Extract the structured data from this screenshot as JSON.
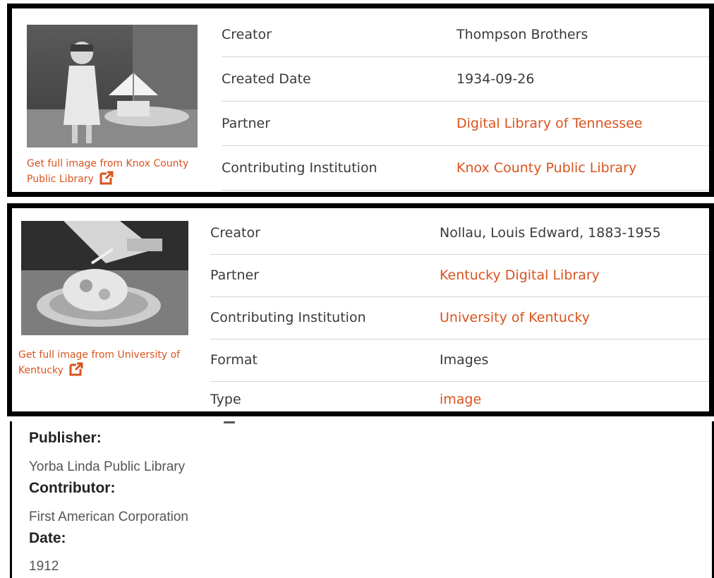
{
  "panel1": {
    "get_full_image": "Get full image from Knox County Public Library",
    "rows": [
      {
        "label": "Creator",
        "value": "Thompson Brothers",
        "link": false
      },
      {
        "label": "Created Date",
        "value": "1934-09-26",
        "link": false
      },
      {
        "label": "Partner",
        "value": "Digital Library of Tennessee",
        "link": true
      },
      {
        "label": "Contributing Institution",
        "value": "Knox County Public Library",
        "link": true
      }
    ]
  },
  "panel2": {
    "get_full_image": "Get full image from University of Kentucky",
    "rows": [
      {
        "label": "Creator",
        "value": "Nollau, Louis Edward, 1883-1955",
        "link": false
      },
      {
        "label": "Partner",
        "value": "Kentucky Digital Library",
        "link": true
      },
      {
        "label": "Contributing Institution",
        "value": "University of Kentucky",
        "link": true
      },
      {
        "label": "Format",
        "value": "Images",
        "link": false
      },
      {
        "label": "Type",
        "value": "image",
        "link": true
      }
    ]
  },
  "panel3": {
    "fields": [
      {
        "label": "Publisher:",
        "value": "Yorba Linda Public Library"
      },
      {
        "label": "Contributor:",
        "value": "First American Corporation"
      },
      {
        "label": "Date:",
        "value": "1912"
      }
    ]
  },
  "colors": {
    "link": "#d9531e",
    "border": "#000000",
    "text": "#3a3a3a"
  },
  "icons": {
    "external_link": "external-link-icon"
  }
}
